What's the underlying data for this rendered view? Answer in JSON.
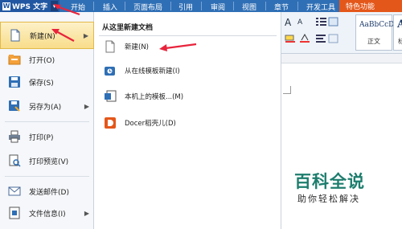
{
  "app": {
    "logo_text": "W",
    "name": "WPS 文字",
    "dropdown_glyph": "▾"
  },
  "tabs": [
    "开始",
    "插入",
    "页面布局",
    "引用",
    "审阅",
    "视图",
    "章节",
    "开发工具"
  ],
  "special_tab": "特色功能",
  "left_menu": {
    "items": [
      {
        "label": "新建(N)",
        "icon": "new-document-icon",
        "has_submenu": true,
        "active": true
      },
      {
        "label": "打开(O)",
        "icon": "open-folder-icon",
        "has_submenu": false
      },
      {
        "label": "保存(S)",
        "icon": "save-icon",
        "has_submenu": false
      },
      {
        "label": "另存为(A)",
        "icon": "save-as-icon",
        "has_submenu": true
      },
      {
        "label": "打印(P)",
        "icon": "print-icon",
        "has_submenu": false
      },
      {
        "label": "打印预览(V)",
        "icon": "print-preview-icon",
        "has_submenu": false
      },
      {
        "label": "发送邮件(D)",
        "icon": "send-mail-icon",
        "has_submenu": false
      },
      {
        "label": "文件信息(I)",
        "icon": "file-info-icon",
        "has_submenu": true
      }
    ],
    "chevron": "▶"
  },
  "submenu": {
    "title": "从这里新建文档",
    "items": [
      {
        "label": "新建(N)",
        "icon": "blank-document-icon"
      },
      {
        "label": "从在线模板新建(I)",
        "icon": "online-template-icon"
      },
      {
        "label": "本机上的模板...(M)",
        "icon": "local-template-icon"
      },
      {
        "label": "Docer稻壳儿(D)",
        "icon": "docer-icon"
      }
    ]
  },
  "ribbon": {
    "styles": [
      {
        "sample": "AaBbCcDd",
        "name": "正文"
      },
      {
        "sample": "A",
        "name": "标"
      }
    ],
    "glyphs": {
      "font_grow": "A",
      "font_shrink": "A"
    }
  },
  "watermark": {
    "main": "百科全说",
    "sub": "助你轻松解决"
  },
  "colors": {
    "top_bar": "#2f6fb5",
    "special_tab": "#e4571a",
    "active_item": "#f8dc8a",
    "annotation_arrow": "#e8243c",
    "watermark": "#1d7d6d"
  }
}
